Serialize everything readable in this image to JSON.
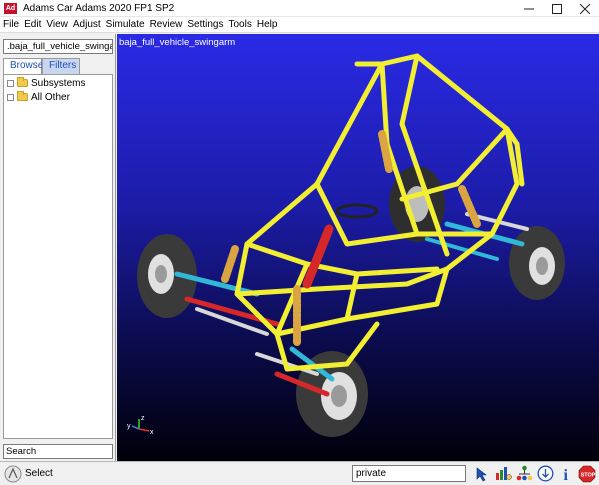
{
  "window": {
    "title": "Adams Car Adams 2020 FP1 SP2",
    "app_icon": "Ad",
    "controls": [
      "minimize-icon",
      "maximize-icon",
      "close-icon"
    ]
  },
  "menu": [
    "File",
    "Edit",
    "View",
    "Adjust",
    "Simulate",
    "Review",
    "Settings",
    "Tools",
    "Help"
  ],
  "browser": {
    "model_name": ".baja_full_vehicle_swingarm",
    "tabs": [
      "Browse",
      "Filters"
    ],
    "active_tab": "Browse",
    "tree": [
      {
        "label": "Subsystems",
        "icon": "folder-icon"
      },
      {
        "label": "All Other",
        "icon": "folder-icon"
      }
    ],
    "search_placeholder": "Search"
  },
  "viewport": {
    "label": "baja_full_vehicle_swingarm",
    "triad": {
      "x": "x",
      "y": "y",
      "z": "z"
    },
    "colors": {
      "frame": "#f2ef32",
      "tire": "#3a3a3a",
      "spring": "#d9a441",
      "damper": "#d62828",
      "arm_blue": "#30b8d8",
      "arm_white": "#d8d8d8"
    }
  },
  "statusbar": {
    "mode_label": "Select",
    "user_field": "private",
    "tools": [
      "select-pointer-icon",
      "plot-icon",
      "model-tree-icon",
      "info-circle-icon",
      "info-icon",
      "stop-icon"
    ]
  }
}
